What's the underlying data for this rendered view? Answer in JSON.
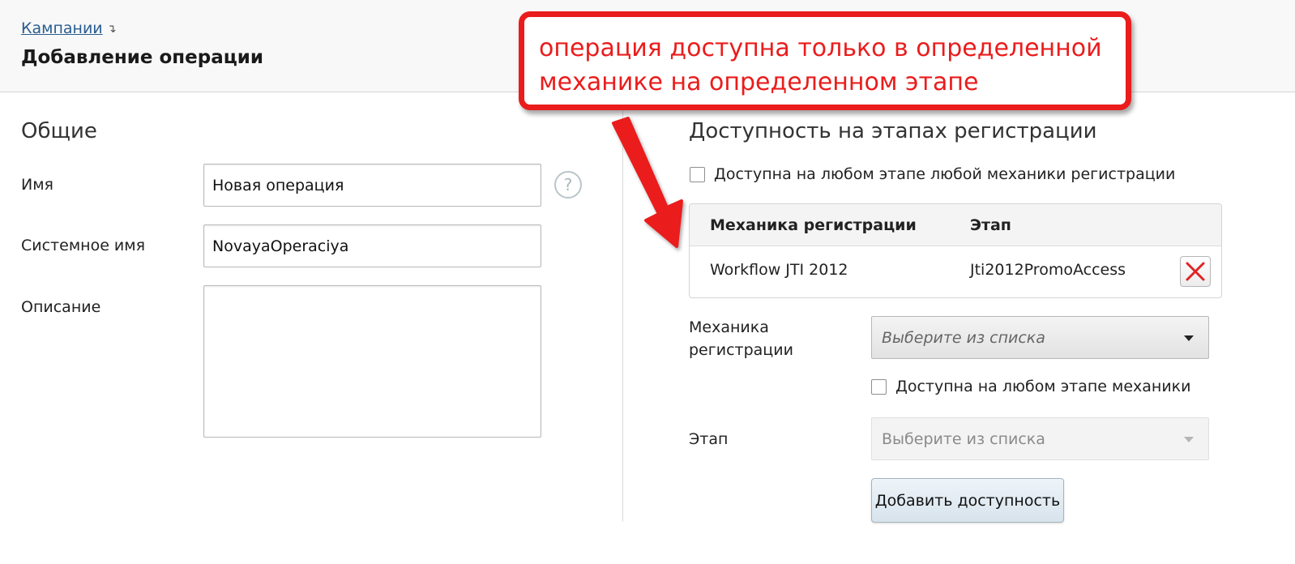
{
  "header": {
    "breadcrumb": "Кампании",
    "breadcrumb_arrow": "↴",
    "title": "Добавление операции"
  },
  "general": {
    "title": "Общие",
    "name_label": "Имя",
    "name_value": "Новая операция",
    "help_symbol": "?",
    "system_name_label": "Системное имя",
    "system_name_value": "NovayaOperaciya",
    "description_label": "Описание",
    "description_value": ""
  },
  "availability": {
    "title": "Доступность на этапах регистрации",
    "any_stage_any_mechanic_label": "Доступна на любом этапе любой механики регистрации",
    "any_stage_any_mechanic_checked": false,
    "table": {
      "columns": [
        "Механика регистрации",
        "Этап"
      ],
      "rows": [
        {
          "mechanic": "Workflow JTI 2012",
          "stage": "Jti2012PromoAccess"
        }
      ]
    },
    "mechanic_label": "Механика регистрации",
    "mechanic_select": "Выберите из списка",
    "any_stage_label": "Доступна на любом этапе механики",
    "any_stage_checked": false,
    "stage_label": "Этап",
    "stage_select": "Выберите из списка",
    "add_button": "Добавить доступность"
  },
  "annotation": {
    "text": "операция доступна только в определенной механике на определенном этапе",
    "color": "#ea1c1c"
  },
  "icons": [
    "help-icon",
    "delete-icon",
    "dropdown-caret-icon",
    "annotation-arrow-icon"
  ]
}
